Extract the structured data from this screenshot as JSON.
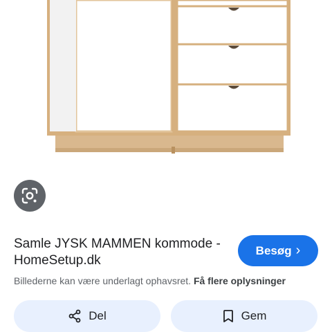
{
  "result": {
    "title": "Samle JYSK MAMMEN kommode - HomeSetup.dk",
    "visit_label": "Besøg",
    "copyright_text": "Billederne kan være underlagt ophavsret.",
    "more_info_label": "Få flere oplysninger"
  },
  "actions": {
    "share_label": "Del",
    "save_label": "Gem"
  },
  "icons": {
    "lens": "google-lens-icon",
    "visit": "chevron-right-icon",
    "share": "share-icon",
    "save": "bookmark-icon"
  },
  "colors": {
    "accent": "#1a73e8",
    "button_bg": "#e8f0fe",
    "lens_bg": "#5f6368"
  }
}
